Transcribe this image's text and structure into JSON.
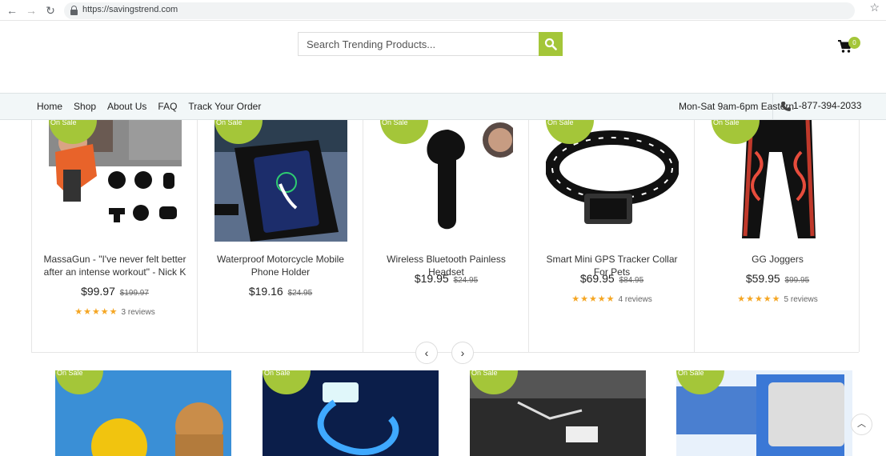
{
  "browser": {
    "url": "https://savingstrend.com"
  },
  "header": {
    "search_placeholder": "Search Trending Products...",
    "cart_count": "0"
  },
  "nav": {
    "links": [
      "Home",
      "Shop",
      "About Us",
      "FAQ",
      "Track Your Order"
    ],
    "hours": "Mon-Sat 9am-6pm Eastern",
    "phone": "1-877-394-2033"
  },
  "badge_label": "On Sale",
  "products": [
    {
      "title": "MassaGun - \"I've never felt better after an intense workout\" - Nick K",
      "price": "$99.97",
      "old_price": "$199.97",
      "stars": "★★★★★",
      "reviews": "3 reviews"
    },
    {
      "title": "Waterproof Motorcycle Mobile Phone Holder",
      "price": "$19.16",
      "old_price": "$24.95",
      "stars": "",
      "reviews": ""
    },
    {
      "title": "Wireless Bluetooth Painless Headset",
      "price": "$19.95",
      "old_price": "$24.95",
      "stars": "",
      "reviews": ""
    },
    {
      "title": "Smart Mini GPS Tracker Collar For Pets",
      "price": "$69.95",
      "old_price": "$84.95",
      "stars": "★★★★★",
      "reviews": "4 reviews"
    },
    {
      "title": "GG Joggers",
      "price": "$59.95",
      "old_price": "$99.95",
      "stars": "★★★★★",
      "reviews": "5 reviews"
    }
  ],
  "colors": {
    "accent": "#a4c639",
    "star": "#f5a623"
  }
}
